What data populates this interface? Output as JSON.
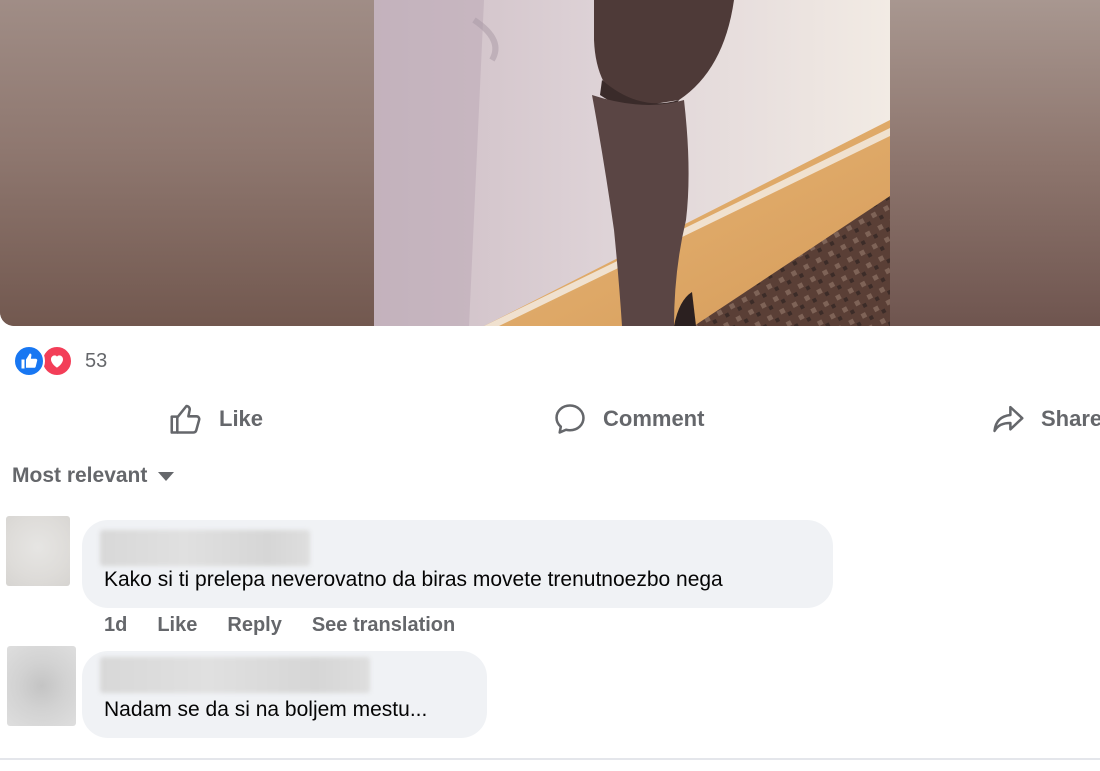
{
  "post": {
    "reactions": {
      "icons": [
        "like-reaction-icon",
        "love-reaction-icon"
      ],
      "count": "53",
      "colors": {
        "like": "#1877f2",
        "love": "#f33e58"
      }
    },
    "actions": {
      "like_label": "Like",
      "comment_label": "Comment",
      "share_label": "Share"
    }
  },
  "comments_section": {
    "sort_label": "Most relevant",
    "comments": [
      {
        "author_hidden": true,
        "text": "Kako si ti prelepa neverovatno da biras movete trenutnoezbo nega",
        "time": "1d",
        "like_label": "Like",
        "reply_label": "Reply",
        "translate_label": "See translation"
      },
      {
        "author_hidden": true,
        "text": "Nadam se da si na boljem mestu..."
      }
    ]
  },
  "theme": {
    "secondary_text": "#65676b",
    "bubble_bg": "#f0f2f5",
    "primary_text": "#050505"
  }
}
